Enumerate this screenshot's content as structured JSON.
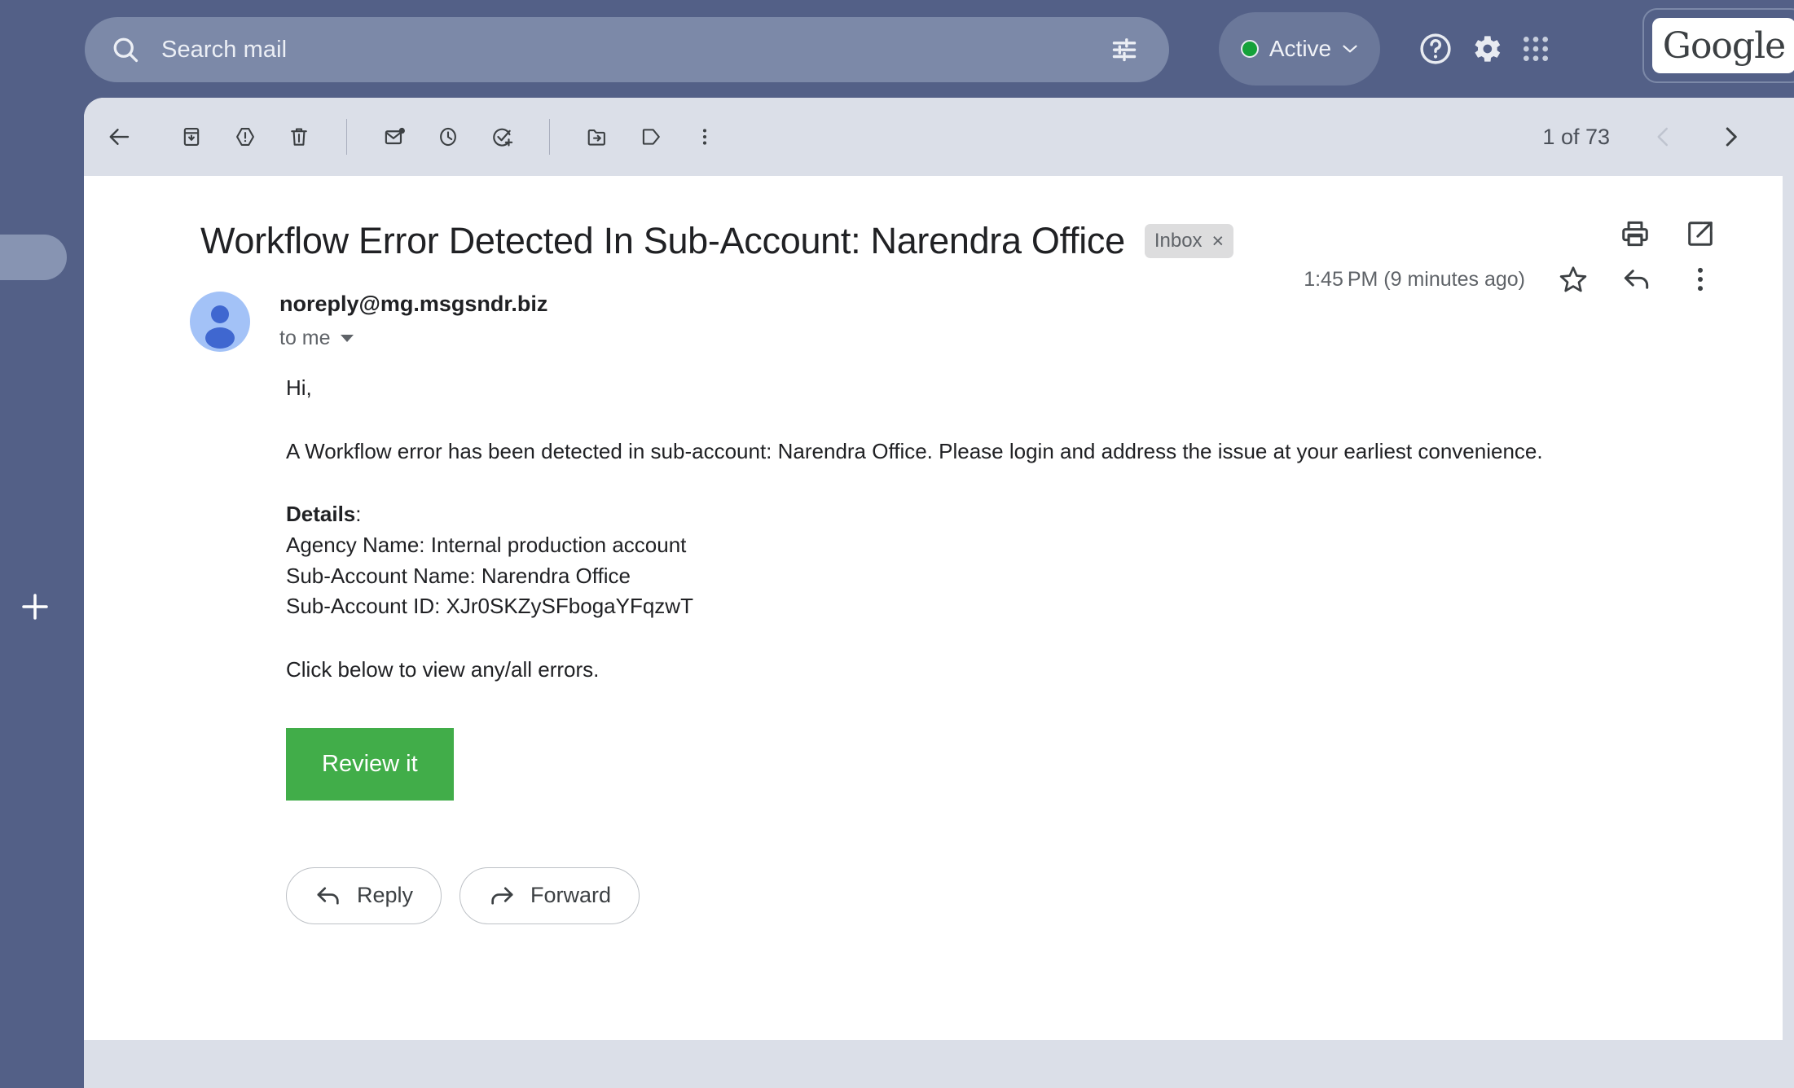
{
  "colors": {
    "rail_bg": "#536087",
    "search_bg": "#7c89a8",
    "toolbar_bg": "#dbdfe8",
    "cta_green": "#41ad49",
    "status_dot_green": "#15a13a",
    "chip_bg": "#ddddde",
    "avatar_light": "#a3c2f7",
    "avatar_dark": "#3f67d0"
  },
  "topbar": {
    "search": {
      "placeholder": "Search mail",
      "value": "",
      "icon": "search-icon",
      "filter_icon": "tune-icon"
    },
    "status": {
      "label": "Active",
      "dot_icon": "status-dot-icon",
      "caret_icon": "chevron-down-icon"
    },
    "help_icon": "help-circle-icon",
    "settings_icon": "gear-icon",
    "apps_icon": "apps-grid-icon",
    "account_card_label": "Google"
  },
  "rail": {
    "add_icon": "plus-icon",
    "tab_icon": "rail-tab-handle"
  },
  "toolbar": {
    "buttons": [
      {
        "name": "back-button",
        "icon": "arrow-left-icon"
      },
      {
        "name": "archive-button",
        "icon": "archive-icon"
      },
      {
        "name": "report-spam-button",
        "icon": "report-spam-icon"
      },
      {
        "name": "delete-button",
        "icon": "trash-icon"
      },
      {
        "name": "mark-unread-button",
        "icon": "mark-unread-icon"
      },
      {
        "name": "snooze-button",
        "icon": "clock-icon"
      },
      {
        "name": "add-to-tasks-button",
        "icon": "task-check-icon"
      },
      {
        "name": "move-to-button",
        "icon": "folder-move-icon"
      },
      {
        "name": "labels-button",
        "icon": "label-tag-icon"
      },
      {
        "name": "more-options-button",
        "icon": "more-vertical-icon"
      }
    ],
    "pager": {
      "count_text": "1 of 73",
      "prev_icon": "chevron-left-icon",
      "next_icon": "chevron-right-icon",
      "prev_disabled": true
    }
  },
  "message": {
    "subject": "Workflow Error Detected In Sub-Account: Narendra Office",
    "label_chip": {
      "text": "Inbox",
      "remove_icon": "close-icon",
      "remove_glyph": "×"
    },
    "header_actions": {
      "print_icon": "print-icon",
      "popout_icon": "open-in-new-icon"
    },
    "sender": {
      "email": "noreply@mg.msgsndr.biz",
      "recipient_text": "to me",
      "avatar_icon": "avatar-person-icon"
    },
    "meta": {
      "timestamp": "1:45 PM (9 minutes ago)",
      "star_icon": "star-icon",
      "reply_icon": "reply-arrow-icon",
      "more_icon": "more-vertical-icon"
    },
    "body": {
      "greeting": "Hi,",
      "intro": "A Workflow error has been detected in sub-account: Narendra Office. Please login and address the issue at your earliest convenience.",
      "details_heading": "Details",
      "details_heading_colon": ":",
      "detail_lines": [
        "Agency Name: Internal production account",
        "Sub-Account Name: Narendra Office",
        "Sub-Account ID: XJr0SKZySFbogaYFqzwT"
      ],
      "cta_intro": "Click below to view any/all errors.",
      "cta_label": "Review it"
    },
    "footer_actions": {
      "reply_label": "Reply",
      "forward_label": "Forward",
      "reply_icon": "reply-arrow-icon",
      "forward_icon": "forward-arrow-icon"
    }
  }
}
